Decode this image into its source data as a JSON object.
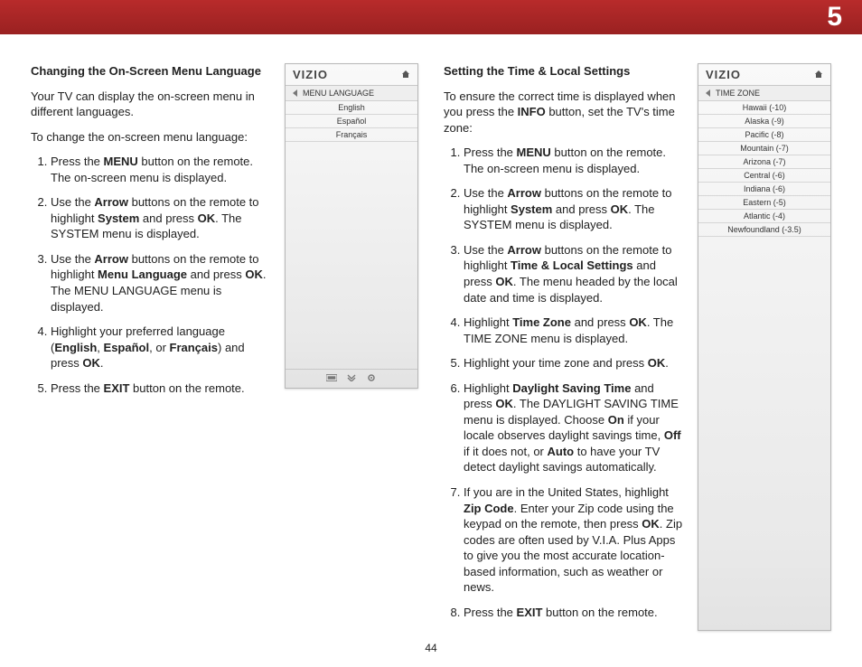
{
  "chapter": "5",
  "page_number": "44",
  "left": {
    "title": "Changing the On-Screen Menu Language",
    "intro": "Your TV can display the on-screen menu in different languages.",
    "intro2": "To change the on-screen menu language:",
    "steps": [
      {
        "pre": "Press the ",
        "b1": "MENU",
        "post": " button on the remote. The on-screen menu is displayed."
      },
      {
        "pre": "Use the ",
        "b1": "Arrow",
        "mid1": " buttons on the remote to highlight ",
        "b2": "System",
        "mid2": " and press ",
        "b3": "OK",
        "post": ". The SYSTEM menu is displayed."
      },
      {
        "pre": "Use the ",
        "b1": "Arrow",
        "mid1": " buttons on the remote to highlight ",
        "b2": "Menu Language",
        "mid2": " and press ",
        "b3": "OK",
        "post": ". The MENU LANGUAGE menu is displayed."
      },
      {
        "pre": "Highlight your preferred language (",
        "b1": "English",
        "mid1": ", ",
        "b2": "Español",
        "mid2": ", or ",
        "b3": "Français",
        "mid3": ") and press ",
        "b4": "OK",
        "post": "."
      },
      {
        "pre": "Press the ",
        "b1": "EXIT",
        "post": " button on the remote."
      }
    ],
    "menu": {
      "logo": "VIZIO",
      "sub": "MENU LANGUAGE",
      "items": [
        "English",
        "Español",
        "Français"
      ]
    }
  },
  "right": {
    "title": "Setting the Time & Local Settings",
    "intro_pre": "To ensure the correct time is displayed when you press the ",
    "intro_b": "INFO",
    "intro_post": " button, set the TV's time zone:",
    "steps": [
      {
        "pre": "Press the ",
        "b1": "MENU",
        "post": " button on the remote. The on-screen menu is displayed."
      },
      {
        "pre": "Use the ",
        "b1": "Arrow",
        "mid1": " buttons on the remote to highlight ",
        "b2": "System",
        "mid2": " and press ",
        "b3": "OK",
        "post": ". The SYSTEM menu is displayed."
      },
      {
        "pre": "Use the ",
        "b1": "Arrow",
        "mid1": " buttons on the remote to highlight ",
        "b2": "Time & Local Settings",
        "mid2": " and press ",
        "b3": "OK",
        "post": ". The menu headed by the local date and time is displayed."
      },
      {
        "pre": "Highlight ",
        "b1": "Time Zone",
        "mid1": " and press ",
        "b2": "OK",
        "post": ". The TIME ZONE menu is displayed."
      },
      {
        "pre": "Highlight your time zone and press ",
        "b1": "OK",
        "post": "."
      },
      {
        "pre": "Highlight ",
        "b1": "Daylight Saving Time",
        "mid1": " and press ",
        "b2": "OK",
        "mid2": ". The DAYLIGHT SAVING TIME menu is displayed. Choose ",
        "b3": "On",
        "mid3": " if your locale observes daylight savings time, ",
        "b4": "Off",
        "mid4": " if it does not, or ",
        "b5": "Auto",
        "post": " to have your TV detect daylight savings automatically."
      },
      {
        "pre": "If you are in the United States, highlight ",
        "b1": "Zip Code",
        "mid1": ". Enter your Zip code using the keypad on the remote, then press ",
        "b2": "OK",
        "post": ". Zip codes are often used by V.I.A. Plus Apps to give you the most accurate location-based information, such as weather or news."
      },
      {
        "pre": "Press the ",
        "b1": "EXIT",
        "post": " button on the remote."
      }
    ],
    "menu": {
      "logo": "VIZIO",
      "sub": "TIME ZONE",
      "items": [
        "Hawaii (-10)",
        "Alaska (-9)",
        "Pacific (-8)",
        "Mountain (-7)",
        "Arizona (-7)",
        "Central (-6)",
        "Indiana (-6)",
        "Eastern (-5)",
        "Atlantic (-4)",
        "Newfoundland (-3.5)"
      ]
    }
  }
}
